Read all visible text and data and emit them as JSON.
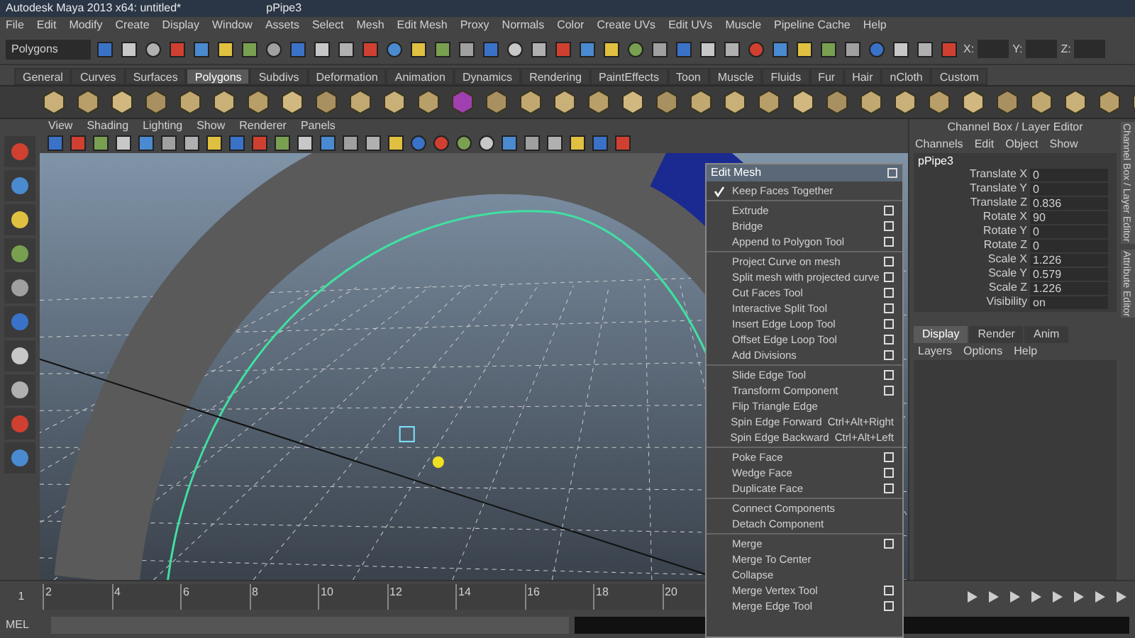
{
  "window": {
    "title": "Autodesk Maya 2013 x64: untitled*",
    "object": "pPipe3"
  },
  "menu_bar": [
    "File",
    "Edit",
    "Modify",
    "Create",
    "Display",
    "Window",
    "Assets",
    "Select",
    "Mesh",
    "Edit Mesh",
    "Proxy",
    "Normals",
    "Color",
    "Create UVs",
    "Edit UVs",
    "Muscle",
    "Pipeline Cache",
    "Help"
  ],
  "status_line": {
    "mode": "Polygons",
    "fields": [
      {
        "label": "X:"
      },
      {
        "label": "Y:"
      },
      {
        "label": "Z:"
      }
    ]
  },
  "shelf_tabs": [
    {
      "label": "General",
      "selected": false
    },
    {
      "label": "Curves",
      "selected": false
    },
    {
      "label": "Surfaces",
      "selected": false
    },
    {
      "label": "Polygons",
      "selected": true
    },
    {
      "label": "Subdivs",
      "selected": false
    },
    {
      "label": "Deformation",
      "selected": false
    },
    {
      "label": "Animation",
      "selected": false
    },
    {
      "label": "Dynamics",
      "selected": false
    },
    {
      "label": "Rendering",
      "selected": false
    },
    {
      "label": "PaintEffects",
      "selected": false
    },
    {
      "label": "Toon",
      "selected": false
    },
    {
      "label": "Muscle",
      "selected": false
    },
    {
      "label": "Fluids",
      "selected": false
    },
    {
      "label": "Fur",
      "selected": false
    },
    {
      "label": "Hair",
      "selected": false
    },
    {
      "label": "nCloth",
      "selected": false
    },
    {
      "label": "Custom",
      "selected": false
    }
  ],
  "panel_menu": [
    "View",
    "Shading",
    "Lighting",
    "Show",
    "Renderer",
    "Panels"
  ],
  "edit_mesh_menu": {
    "title": "Edit Mesh",
    "groups": [
      [
        {
          "label": "Keep Faces Together",
          "kind": "check",
          "checked": true
        }
      ],
      [
        {
          "label": "Extrude",
          "kind": "option"
        },
        {
          "label": "Bridge",
          "kind": "option"
        },
        {
          "label": "Append to Polygon Tool",
          "kind": "option"
        }
      ],
      [
        {
          "label": "Project Curve on mesh",
          "kind": "option"
        },
        {
          "label": "Split mesh with projected curve",
          "kind": "option"
        },
        {
          "label": "Cut Faces Tool",
          "kind": "option"
        },
        {
          "label": "Interactive Split Tool",
          "kind": "option"
        },
        {
          "label": "Insert Edge Loop Tool",
          "kind": "option"
        },
        {
          "label": "Offset Edge Loop Tool",
          "kind": "option"
        },
        {
          "label": "Add Divisions",
          "kind": "option"
        }
      ],
      [
        {
          "label": "Slide Edge Tool",
          "kind": "option"
        },
        {
          "label": "Transform Component",
          "kind": "option"
        },
        {
          "label": "Flip Triangle Edge",
          "kind": "plain"
        },
        {
          "label": "Spin Edge Forward",
          "shortcut": "Ctrl+Alt+Right",
          "kind": "plain"
        },
        {
          "label": "Spin Edge Backward",
          "shortcut": "Ctrl+Alt+Left",
          "kind": "plain"
        }
      ],
      [
        {
          "label": "Poke Face",
          "kind": "option"
        },
        {
          "label": "Wedge Face",
          "kind": "option"
        },
        {
          "label": "Duplicate Face",
          "kind": "option"
        }
      ],
      [
        {
          "label": "Connect Components",
          "kind": "plain"
        },
        {
          "label": "Detach Component",
          "kind": "plain"
        }
      ],
      [
        {
          "label": "Merge",
          "kind": "option"
        },
        {
          "label": "Merge To Center",
          "kind": "plain"
        },
        {
          "label": "Collapse",
          "kind": "plain"
        },
        {
          "label": "Merge Vertex Tool",
          "kind": "option"
        },
        {
          "label": "Merge Edge Tool",
          "kind": "option"
        }
      ]
    ]
  },
  "channel_box": {
    "title": "Channel Box / Layer Editor",
    "menus": [
      "Channels",
      "Edit",
      "Object",
      "Show"
    ],
    "object": "pPipe3",
    "channels": [
      {
        "name": "Translate X",
        "value": "0"
      },
      {
        "name": "Translate Y",
        "value": "0"
      },
      {
        "name": "Translate Z",
        "value": "0.836"
      },
      {
        "name": "Rotate X",
        "value": "90"
      },
      {
        "name": "Rotate Y",
        "value": "0"
      },
      {
        "name": "Rotate Z",
        "value": "0"
      },
      {
        "name": "Scale X",
        "value": "1.226"
      },
      {
        "name": "Scale Y",
        "value": "0.579"
      },
      {
        "name": "Scale Z",
        "value": "1.226"
      },
      {
        "name": "Visibility",
        "value": "on"
      }
    ]
  },
  "layer_editor": {
    "tabs": [
      {
        "label": "Display",
        "selected": true
      },
      {
        "label": "Render",
        "selected": false
      },
      {
        "label": "Anim",
        "selected": false
      }
    ],
    "menus": [
      "Layers",
      "Options",
      "Help"
    ]
  },
  "side_tabs": [
    "Channel Box / Layer Editor",
    "Attribute Editor"
  ],
  "timeline": {
    "start": "1",
    "ticks": [
      "2",
      "4",
      "6",
      "8",
      "10",
      "12",
      "14",
      "16",
      "18",
      "20"
    ]
  },
  "command_line": {
    "label": "MEL"
  }
}
